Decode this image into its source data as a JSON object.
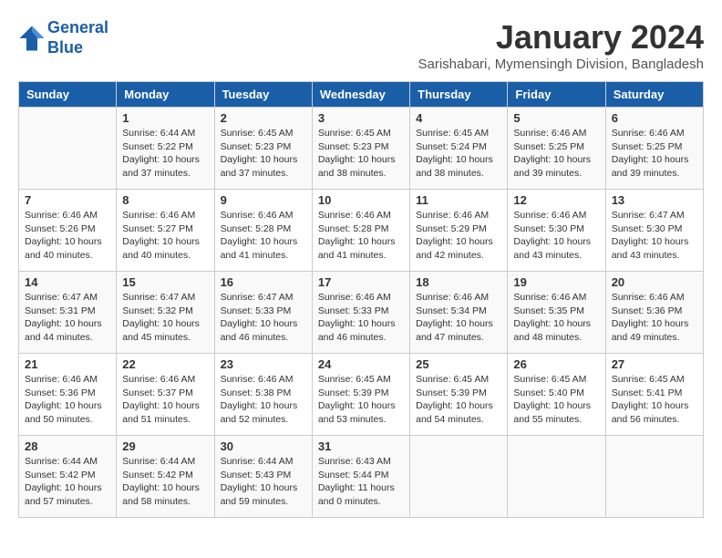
{
  "header": {
    "logo_line1": "General",
    "logo_line2": "Blue",
    "month_title": "January 2024",
    "location": "Sarishabari, Mymensingh Division, Bangladesh"
  },
  "days_of_week": [
    "Sunday",
    "Monday",
    "Tuesday",
    "Wednesday",
    "Thursday",
    "Friday",
    "Saturday"
  ],
  "weeks": [
    [
      {
        "num": "",
        "info": ""
      },
      {
        "num": "1",
        "info": "Sunrise: 6:44 AM\nSunset: 5:22 PM\nDaylight: 10 hours\nand 37 minutes."
      },
      {
        "num": "2",
        "info": "Sunrise: 6:45 AM\nSunset: 5:23 PM\nDaylight: 10 hours\nand 37 minutes."
      },
      {
        "num": "3",
        "info": "Sunrise: 6:45 AM\nSunset: 5:23 PM\nDaylight: 10 hours\nand 38 minutes."
      },
      {
        "num": "4",
        "info": "Sunrise: 6:45 AM\nSunset: 5:24 PM\nDaylight: 10 hours\nand 38 minutes."
      },
      {
        "num": "5",
        "info": "Sunrise: 6:46 AM\nSunset: 5:25 PM\nDaylight: 10 hours\nand 39 minutes."
      },
      {
        "num": "6",
        "info": "Sunrise: 6:46 AM\nSunset: 5:25 PM\nDaylight: 10 hours\nand 39 minutes."
      }
    ],
    [
      {
        "num": "7",
        "info": "Sunrise: 6:46 AM\nSunset: 5:26 PM\nDaylight: 10 hours\nand 40 minutes."
      },
      {
        "num": "8",
        "info": "Sunrise: 6:46 AM\nSunset: 5:27 PM\nDaylight: 10 hours\nand 40 minutes."
      },
      {
        "num": "9",
        "info": "Sunrise: 6:46 AM\nSunset: 5:28 PM\nDaylight: 10 hours\nand 41 minutes."
      },
      {
        "num": "10",
        "info": "Sunrise: 6:46 AM\nSunset: 5:28 PM\nDaylight: 10 hours\nand 41 minutes."
      },
      {
        "num": "11",
        "info": "Sunrise: 6:46 AM\nSunset: 5:29 PM\nDaylight: 10 hours\nand 42 minutes."
      },
      {
        "num": "12",
        "info": "Sunrise: 6:46 AM\nSunset: 5:30 PM\nDaylight: 10 hours\nand 43 minutes."
      },
      {
        "num": "13",
        "info": "Sunrise: 6:47 AM\nSunset: 5:30 PM\nDaylight: 10 hours\nand 43 minutes."
      }
    ],
    [
      {
        "num": "14",
        "info": "Sunrise: 6:47 AM\nSunset: 5:31 PM\nDaylight: 10 hours\nand 44 minutes."
      },
      {
        "num": "15",
        "info": "Sunrise: 6:47 AM\nSunset: 5:32 PM\nDaylight: 10 hours\nand 45 minutes."
      },
      {
        "num": "16",
        "info": "Sunrise: 6:47 AM\nSunset: 5:33 PM\nDaylight: 10 hours\nand 46 minutes."
      },
      {
        "num": "17",
        "info": "Sunrise: 6:46 AM\nSunset: 5:33 PM\nDaylight: 10 hours\nand 46 minutes."
      },
      {
        "num": "18",
        "info": "Sunrise: 6:46 AM\nSunset: 5:34 PM\nDaylight: 10 hours\nand 47 minutes."
      },
      {
        "num": "19",
        "info": "Sunrise: 6:46 AM\nSunset: 5:35 PM\nDaylight: 10 hours\nand 48 minutes."
      },
      {
        "num": "20",
        "info": "Sunrise: 6:46 AM\nSunset: 5:36 PM\nDaylight: 10 hours\nand 49 minutes."
      }
    ],
    [
      {
        "num": "21",
        "info": "Sunrise: 6:46 AM\nSunset: 5:36 PM\nDaylight: 10 hours\nand 50 minutes."
      },
      {
        "num": "22",
        "info": "Sunrise: 6:46 AM\nSunset: 5:37 PM\nDaylight: 10 hours\nand 51 minutes."
      },
      {
        "num": "23",
        "info": "Sunrise: 6:46 AM\nSunset: 5:38 PM\nDaylight: 10 hours\nand 52 minutes."
      },
      {
        "num": "24",
        "info": "Sunrise: 6:45 AM\nSunset: 5:39 PM\nDaylight: 10 hours\nand 53 minutes."
      },
      {
        "num": "25",
        "info": "Sunrise: 6:45 AM\nSunset: 5:39 PM\nDaylight: 10 hours\nand 54 minutes."
      },
      {
        "num": "26",
        "info": "Sunrise: 6:45 AM\nSunset: 5:40 PM\nDaylight: 10 hours\nand 55 minutes."
      },
      {
        "num": "27",
        "info": "Sunrise: 6:45 AM\nSunset: 5:41 PM\nDaylight: 10 hours\nand 56 minutes."
      }
    ],
    [
      {
        "num": "28",
        "info": "Sunrise: 6:44 AM\nSunset: 5:42 PM\nDaylight: 10 hours\nand 57 minutes."
      },
      {
        "num": "29",
        "info": "Sunrise: 6:44 AM\nSunset: 5:42 PM\nDaylight: 10 hours\nand 58 minutes."
      },
      {
        "num": "30",
        "info": "Sunrise: 6:44 AM\nSunset: 5:43 PM\nDaylight: 10 hours\nand 59 minutes."
      },
      {
        "num": "31",
        "info": "Sunrise: 6:43 AM\nSunset: 5:44 PM\nDaylight: 11 hours\nand 0 minutes."
      },
      {
        "num": "",
        "info": ""
      },
      {
        "num": "",
        "info": ""
      },
      {
        "num": "",
        "info": ""
      }
    ]
  ]
}
